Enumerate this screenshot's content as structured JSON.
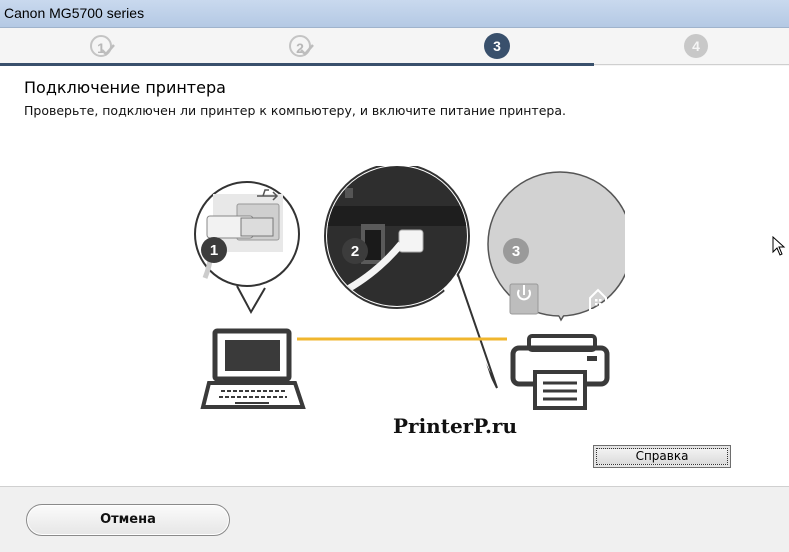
{
  "window": {
    "title": "Canon MG5700 series"
  },
  "steps": [
    {
      "number": "1",
      "state": "done"
    },
    {
      "number": "2",
      "state": "done"
    },
    {
      "number": "3",
      "state": "active"
    },
    {
      "number": "4",
      "state": "future"
    }
  ],
  "page": {
    "title": "Подключение принтера",
    "description": "Проверьте, подключен ли принтер к компьютеру, и включите питание принтера."
  },
  "illustration": {
    "callouts": [
      {
        "number": "1",
        "meaning": "usb-cable-to-computer"
      },
      {
        "number": "2",
        "meaning": "usb-cable-to-printer"
      },
      {
        "number": "3",
        "meaning": "printer-power-on"
      }
    ],
    "icons": [
      "laptop-icon",
      "printer-icon",
      "usb-icon",
      "power-icon",
      "home-icon"
    ],
    "cable_color": "#f0b62e"
  },
  "watermark": "PrinterP.ru",
  "buttons": {
    "help": "Справка",
    "cancel": "Отмена"
  },
  "colors": {
    "accent": "#39506c",
    "titlebar": "#c9d9ee",
    "inactive_step": "#c8c8c8"
  }
}
